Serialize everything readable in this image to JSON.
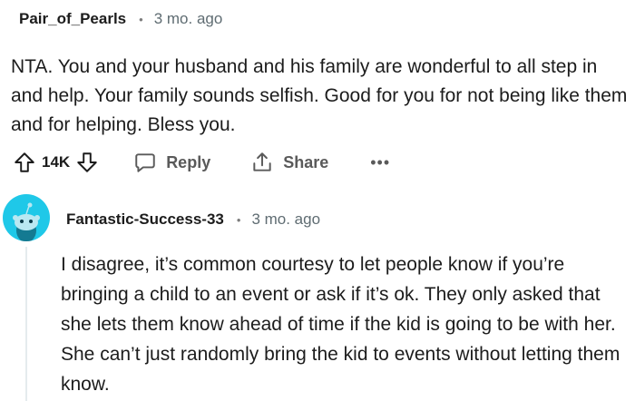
{
  "comment1": {
    "username": "Pair_of_Pearls",
    "separator": "•",
    "time": "3 mo. ago",
    "body": "NTA. You and your husband and his family are wonderful to all step in and help. Your family sounds selfish. Good for you for not being like them and for helping. Bless you.",
    "votes": "14K",
    "reply_label": "Reply",
    "share_label": "Share",
    "more_label": "•••"
  },
  "comment2": {
    "username": "Fantastic-Success-33",
    "separator": "•",
    "time": "3 mo. ago",
    "body": "I disagree, it’s common courtesy to let people know if you’re bringing a child to an event or ask if it’s ok. They only asked that she lets them know ahead of time if the kid is going to be with her. She can’t just randomly bring the kid to events without letting them know."
  },
  "colors": {
    "avatar_bg": "#1fc8e8",
    "meta_text": "#5f6c72",
    "thread_line": "#e5ebee"
  },
  "icons": [
    "upvote-icon",
    "downvote-icon",
    "comment-bubble-icon",
    "share-icon",
    "more-options-icon",
    "snoo-avatar-icon"
  ]
}
